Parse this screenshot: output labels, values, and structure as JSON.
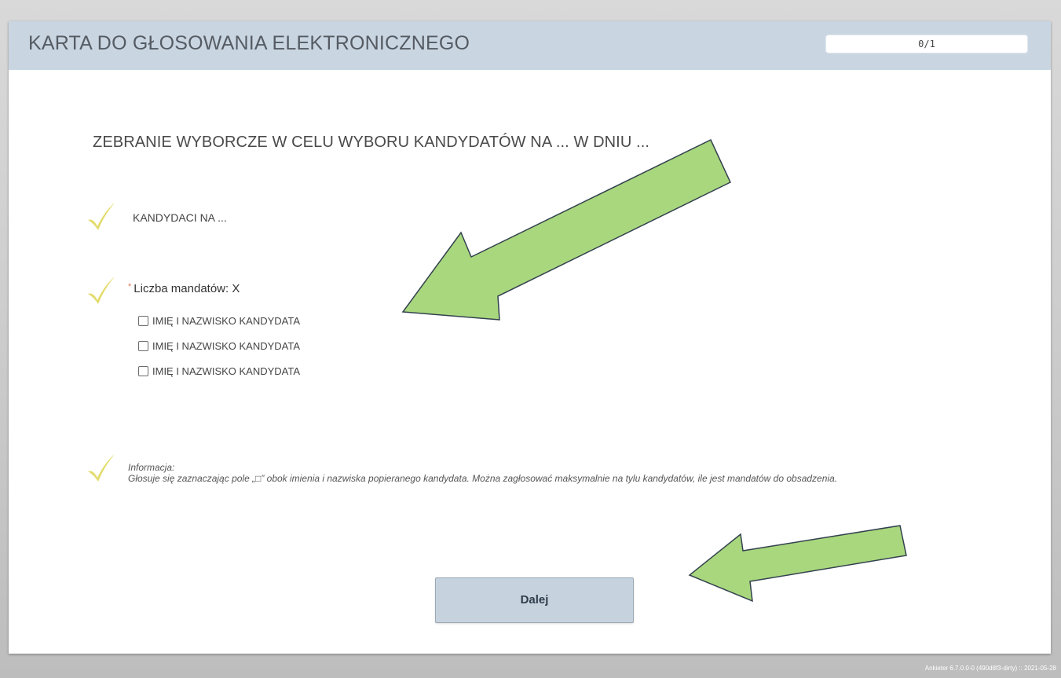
{
  "header": {
    "title": "KARTA DO GŁOSOWANIA ELEKTRONICZNEGO",
    "progress": "0/1",
    "progress_fraction": 0
  },
  "event_title": "ZEBRANIE WYBORCZE W CELU WYBORU KANDYDATÓW NA ... W DNIU ...",
  "section": {
    "label": "KANDYDACI NA ..."
  },
  "question": {
    "required_mark": "*",
    "label": "Liczba mandatów: X",
    "options": [
      {
        "label": "IMIĘ I NAZWISKO KANDYDATA",
        "checked": false
      },
      {
        "label": "IMIĘ I NAZWISKO KANDYDATA",
        "checked": false
      },
      {
        "label": "IMIĘ I NAZWISKO KANDYDATA",
        "checked": false
      }
    ]
  },
  "info": {
    "heading": "Informacja:",
    "body": "Głosuje się zaznaczając pole „□” obok imienia i nazwiska popieranego kandydata. Można zagłosować maksymalnie na tylu kandydatów, ile jest mandatów do obsadzenia."
  },
  "actions": {
    "next_label": "Dalej"
  },
  "footer": {
    "version": "Ankieter 6.7.0.0-0 (490d8f3-dirty) :: 2021-05-28"
  },
  "colors": {
    "header_bg": "#c9d6e2",
    "button_bg": "#c6d3df",
    "check_color": "#e3dc6c",
    "arrow_fill": "#a9d77e",
    "arrow_stroke": "#33414e",
    "required_color": "#e07b61"
  },
  "icons": {
    "check": "checkmark-icon",
    "checkbox": "checkbox-icon",
    "arrow": "arrow-annotation"
  }
}
